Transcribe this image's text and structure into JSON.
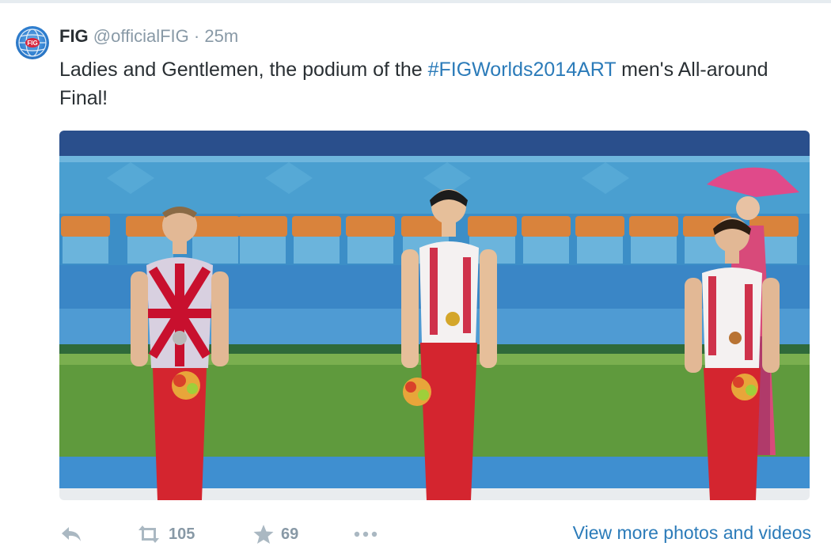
{
  "tweet": {
    "author_name": "FIG",
    "handle": "@officialFIG",
    "separator": "·",
    "time": "25m",
    "text_before": "Ladies and Gentlemen, the podium of the ",
    "hashtag": "#FIGWorlds2014ART",
    "text_after": " men's All-around Final!",
    "avatar_icon": "fig-globe-logo"
  },
  "actions": {
    "reply_icon": "reply-icon",
    "retweet_icon": "retweet-icon",
    "retweet_count": "105",
    "favorite_icon": "star-icon",
    "favorite_count": "69",
    "more_icon": "ellipsis-icon"
  },
  "media": {
    "view_more_label": "View more photos and videos"
  },
  "colors": {
    "link": "#2b7bb9",
    "muted": "#8899a6",
    "text": "#292f33"
  }
}
